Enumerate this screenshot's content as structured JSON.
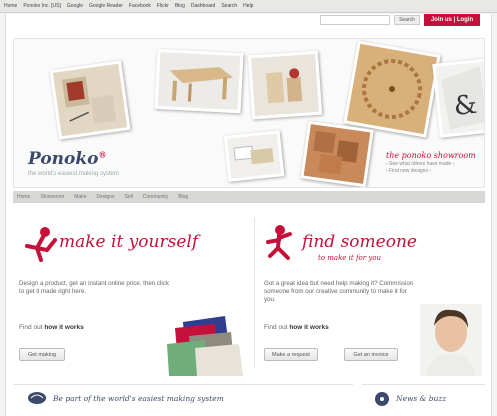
{
  "bookmarks": [
    "Home",
    "Ponoko Inc. [US]",
    "Google",
    "Google Reader",
    "Facebook",
    "Flickr",
    "Blog",
    "Dashboard",
    "Search",
    "Help"
  ],
  "header": {
    "search_placeholder": "",
    "search_button": "Search",
    "signin_button": "Join us | Login"
  },
  "hero": {
    "logo": "Ponoko",
    "logo_mark": "®",
    "tagline": "the world's easiest making system",
    "showroom": {
      "title": "the ponoko showroom",
      "links": [
        "› See what others have made ›",
        "› Find new designs ›"
      ]
    }
  },
  "nav": {
    "items": [
      "Home",
      "Showroom",
      "Make",
      "Designs",
      "Sell",
      "Community",
      "Blog"
    ]
  },
  "make": {
    "title": "make it yourself",
    "body": "Design a product, get an instant online price, then click to get it made right here.",
    "link_prefix": "Find out",
    "link_label": "how it works",
    "button": "Get making"
  },
  "find": {
    "title": "find someone",
    "subtitle": "to make it for you",
    "body": "Got a great idea but need help making it? Commission someone from our creative community to make it for you.",
    "link_prefix": "Find out",
    "link_label": "how it works",
    "button_1": "Make a request",
    "button_2": "Get an invoice"
  },
  "footer": {
    "left_title": "Be part of the world's easiest making system",
    "right_title": "News & buzz"
  },
  "colors": {
    "brand_red": "#c4103a",
    "brand_navy": "#3b4a6b"
  }
}
